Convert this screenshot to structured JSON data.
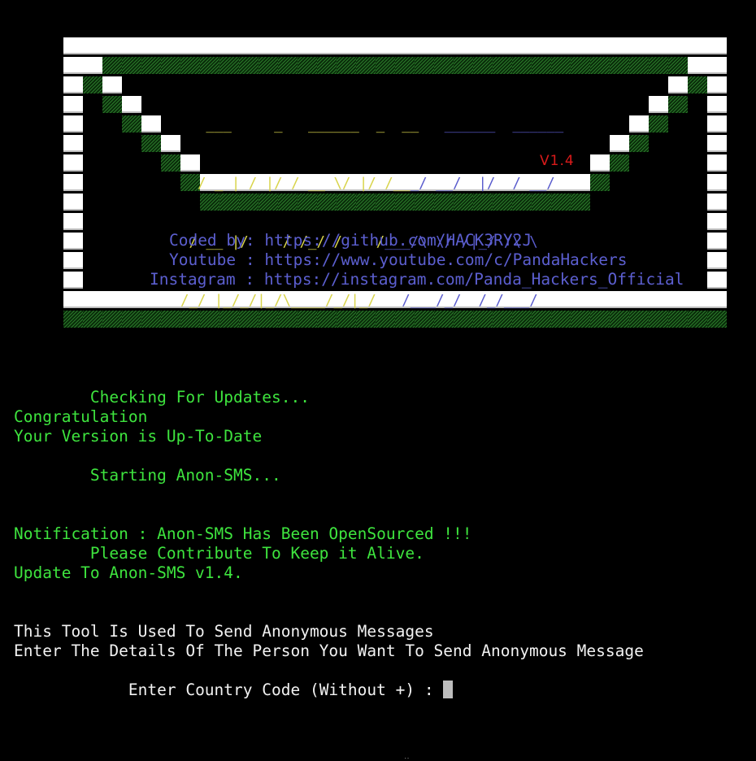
{
  "app": {
    "name": "Anon-SMS",
    "type": "terminal"
  },
  "banner": {
    "logo_ascii_lines": [
      {
        "yellow": "   ___     _   ______  _  __",
        "blue": "   ______  ______"
      },
      {
        "yellow": "  / _ | / |/ / __ \\/ |/ /__",
        "blue": "_/ __/  |/  / __/"
      },
      {
        "yellow": " / __ |/    / /_/ /    /",
        "blue": "___/\\ \\/ /|_/ /\\ \\"
      },
      {
        "yellow": "/_/ |_/_/|_/\\____/_/|_/",
        "blue": "   /___/_/  /_/___/"
      }
    ],
    "version_label": "V1.4",
    "credits": [
      {
        "label": "Coded by: ",
        "value": "https://github.com/HACK3RY2J"
      },
      {
        "label": "Youtube : ",
        "value": "https://www.youtube.com/c/PandaHackers"
      },
      {
        "label": "Instagram : ",
        "value": "https://instagram.com/Panda_Hackers_Official"
      }
    ]
  },
  "output": {
    "update_check": "        Checking For Updates...",
    "congrats": "Congratulation",
    "up_to_date": "Your Version is Up-To-Date",
    "starting": "        Starting Anon-SMS...",
    "notification": "Notification : Anon-SMS Has Been OpenSourced !!!",
    "contribute": "        Please Contribute To Keep it Alive.",
    "update_to": "Update To Anon-SMS v1.4.",
    "tool_desc": "This Tool Is Used To Send Anonymous Messages",
    "details_prompt": "Enter The Details Of The Person You Want To Send Anonymous Message",
    "country_code_prompt": "        Enter Country Code (Without +) : "
  },
  "input": {
    "country_code_value": ""
  },
  "colors": {
    "terminal_bg": "#000000",
    "output_green": "#3ee43e",
    "output_white": "#f2f2f2",
    "logo_yellow": "#d8d44a",
    "logo_blue": "#5a5ccd",
    "credit_blue": "#5c5fd0",
    "version_red": "#d91a1a",
    "banner_white": "#ffffff",
    "banner_green": "#1f5f1f"
  }
}
